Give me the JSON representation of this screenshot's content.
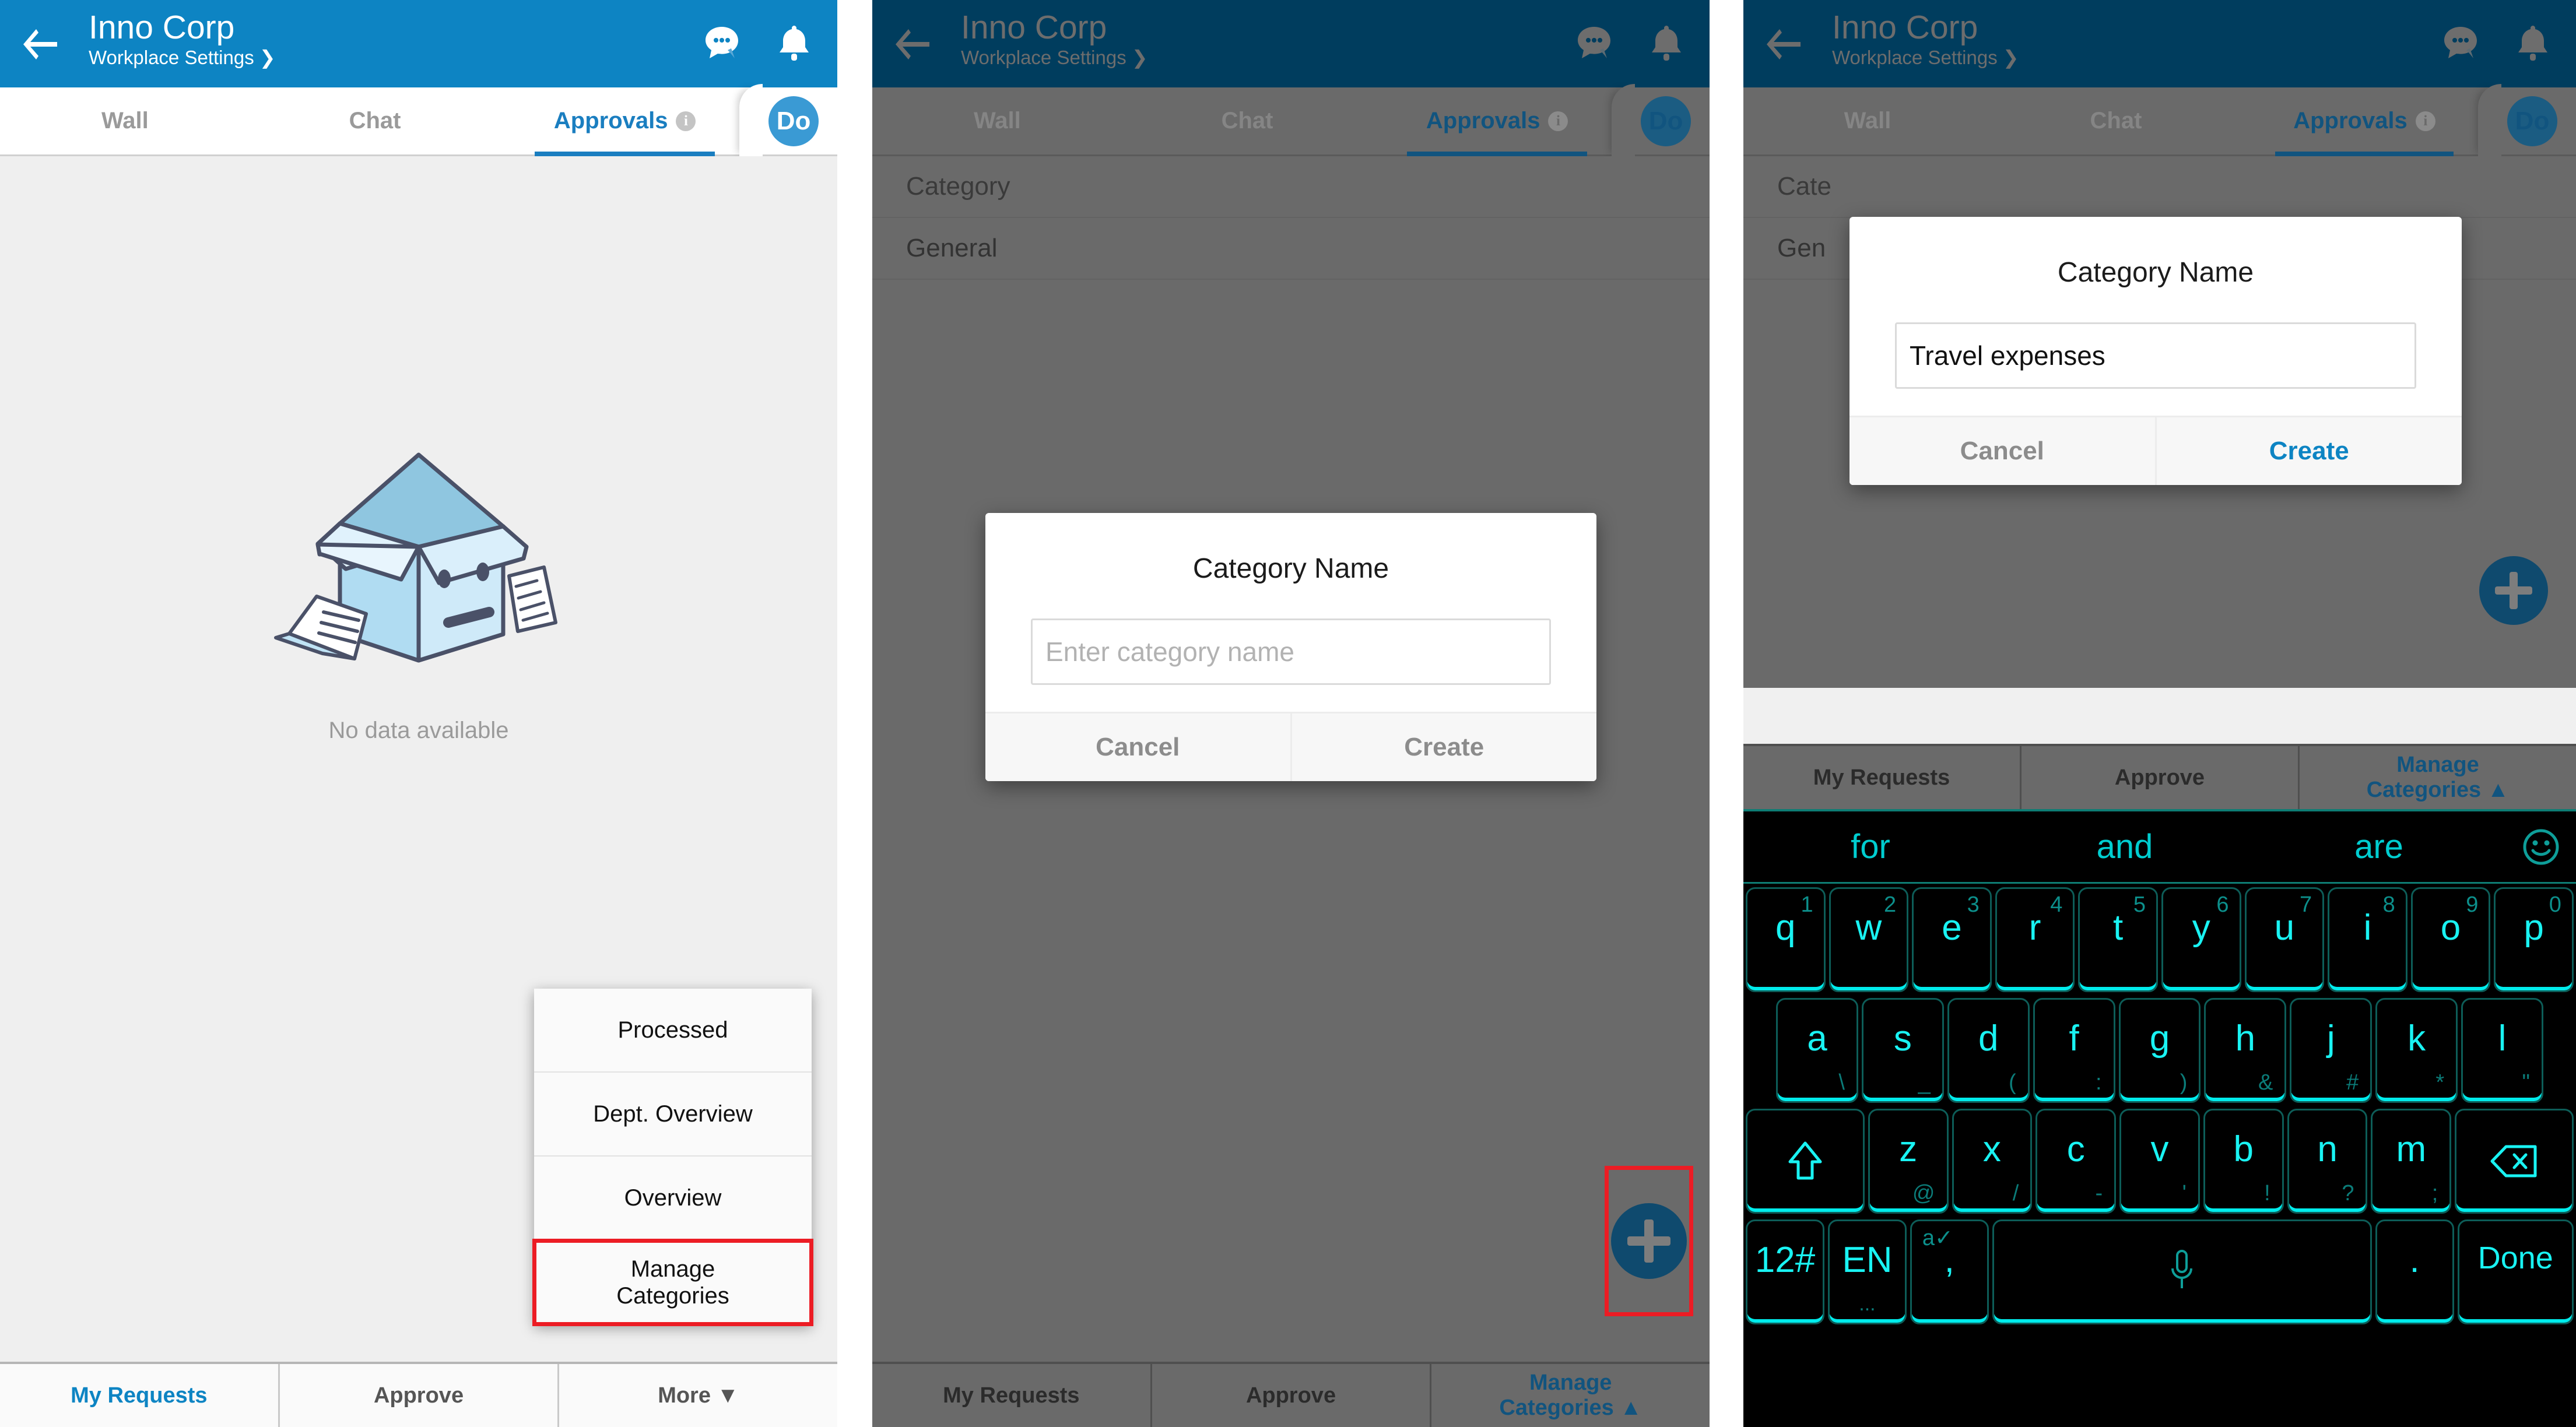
{
  "app": {
    "title": "Inno Corp",
    "subtitle": "Workplace Settings ❯",
    "back_icon": "back-arrow-icon",
    "chat_icon": "chat-bubble-icon",
    "bell_icon": "bell-icon",
    "accent_blue": "#0d84c3",
    "dim_blue": "#003d5e"
  },
  "tabs": {
    "wall": "Wall",
    "chat": "Chat",
    "approvals": "Approvals",
    "info_badge": "i",
    "avatar": "Do"
  },
  "panel1": {
    "empty_text": "No data available",
    "menu": {
      "items": [
        {
          "label": "Processed"
        },
        {
          "label": "Dept. Overview"
        },
        {
          "label": "Overview"
        },
        {
          "label": "Manage\nCategories",
          "line1": "Manage",
          "line2": "Categories",
          "highlighted": true
        }
      ]
    },
    "bottom": {
      "my_requests": "My Requests",
      "approve": "Approve",
      "more": "More ▼"
    }
  },
  "panel2": {
    "list": {
      "header": "Category",
      "row1": "General"
    },
    "dialog": {
      "title": "Category Name",
      "input_value": "",
      "input_placeholder": "Enter category name",
      "cancel": "Cancel",
      "create": "Create"
    },
    "fab": {
      "icon": "plus-icon",
      "highlighted": true
    },
    "bottom": {
      "my_requests": "My Requests",
      "approve": "Approve",
      "manage_line1": "Manage",
      "manage_line2": "Categories ▲"
    }
  },
  "panel3": {
    "list": {
      "header": "Cate",
      "row1": "Gen"
    },
    "dialog": {
      "title": "Category Name",
      "input_value": "Travel expenses",
      "input_placeholder": "Enter category name",
      "cancel": "Cancel",
      "create": "Create"
    },
    "fab": {
      "icon": "plus-icon"
    },
    "bottom": {
      "my_requests": "My Requests",
      "approve": "Approve",
      "manage_line1": "Manage",
      "manage_line2": "Categories ▲"
    },
    "keyboard": {
      "suggestions": [
        "for",
        "and",
        "are"
      ],
      "emoji_icon": "smiley-icon",
      "row1": [
        {
          "main": "q",
          "sub": "1"
        },
        {
          "main": "w",
          "sub": "2"
        },
        {
          "main": "e",
          "sub": "3"
        },
        {
          "main": "r",
          "sub": "4"
        },
        {
          "main": "t",
          "sub": "5"
        },
        {
          "main": "y",
          "sub": "6"
        },
        {
          "main": "u",
          "sub": "7"
        },
        {
          "main": "i",
          "sub": "8"
        },
        {
          "main": "o",
          "sub": "9"
        },
        {
          "main": "p",
          "sub": "0"
        }
      ],
      "row2": [
        {
          "main": "a",
          "sub": "\\"
        },
        {
          "main": "s",
          "sub": "_"
        },
        {
          "main": "d",
          "sub": "("
        },
        {
          "main": "f",
          "sub": ":"
        },
        {
          "main": "g",
          "sub": ")"
        },
        {
          "main": "h",
          "sub": "&"
        },
        {
          "main": "j",
          "sub": "#"
        },
        {
          "main": "k",
          "sub": "*"
        },
        {
          "main": "l",
          "sub": "\""
        }
      ],
      "row3": [
        {
          "main": "z",
          "sub": "@"
        },
        {
          "main": "x",
          "sub": "/"
        },
        {
          "main": "c",
          "sub": "-"
        },
        {
          "main": "v",
          "sub": "'"
        },
        {
          "main": "b",
          "sub": "!"
        },
        {
          "main": "n",
          "sub": "?"
        },
        {
          "main": "m",
          "sub": ";"
        }
      ],
      "shift_icon": "shift-up-arrow-icon",
      "backspace_icon": "backspace-icon",
      "numeric_key": "12#",
      "language_key": "EN",
      "language_sub": "...",
      "comma_key": ",",
      "comma_sub": "a✓",
      "space_icon": "microphone-icon",
      "period_key": ".",
      "done_key": "Done"
    }
  }
}
